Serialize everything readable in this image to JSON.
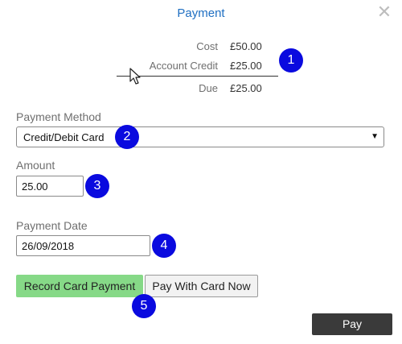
{
  "dialog": {
    "title": "Payment"
  },
  "summary": {
    "cost_label": "Cost",
    "cost_value": "£50.00",
    "credit_label": "Account Credit",
    "credit_value": "£25.00",
    "due_label": "Due",
    "due_value": "£25.00"
  },
  "form": {
    "payment_method_label": "Payment Method",
    "payment_method_value": "Credit/Debit Card",
    "amount_label": "Amount",
    "amount_value": "25.00",
    "payment_date_label": "Payment Date",
    "payment_date_value": "26/09/2018"
  },
  "buttons": {
    "record": "Record Card Payment",
    "pay_now": "Pay With Card Now",
    "pay": "Pay"
  },
  "badges": [
    "1",
    "2",
    "3",
    "4",
    "5"
  ],
  "colors": {
    "title": "#1f6fc2",
    "badge": "#0a0adf",
    "record_button": "#86d987",
    "pay_button": "#3a3a3a"
  },
  "icons": {
    "close": "close-icon",
    "caret": "chevron-down-icon",
    "cursor": "mouse-pointer-icon"
  }
}
